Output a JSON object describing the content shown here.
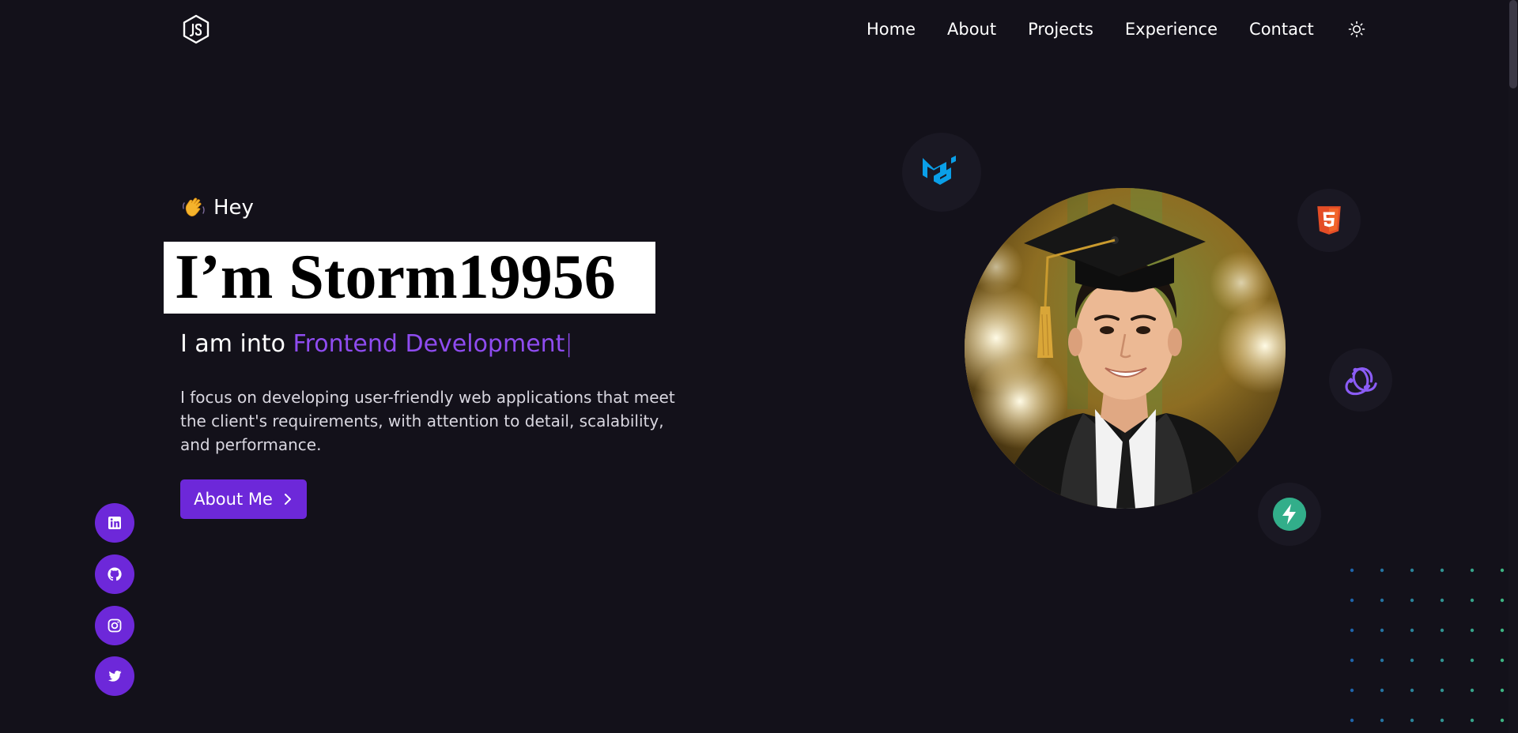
{
  "nav": {
    "logo_icon": "nodejs-logo-icon",
    "items": [
      {
        "label": "Home"
      },
      {
        "label": "About"
      },
      {
        "label": "Projects"
      },
      {
        "label": "Experience"
      },
      {
        "label": "Contact"
      }
    ],
    "theme_toggle_icon": "sun-icon"
  },
  "hero": {
    "greeting_icon": "waving-hand-icon",
    "greeting": "Hey",
    "name": "I’m Storm19956",
    "into_prefix": "I am into",
    "into_role": "Frontend Development",
    "cursor": "|",
    "description": "I focus on developing user-friendly web applications that meet the client's requirements, with attention to detail, scalability, and performance.",
    "button_label": "About Me",
    "button_icon": "chevron-right-icon"
  },
  "socials": [
    {
      "icon": "linkedin-icon"
    },
    {
      "icon": "github-icon"
    },
    {
      "icon": "instagram-icon"
    },
    {
      "icon": "twitter-icon"
    }
  ],
  "tech_icons": [
    "material-ui-icon",
    "html5-icon",
    "redux-icon",
    "supabase-icon"
  ],
  "colors": {
    "background": "#13111a",
    "accent": "#8f4cf0",
    "button": "#6d28d9"
  }
}
